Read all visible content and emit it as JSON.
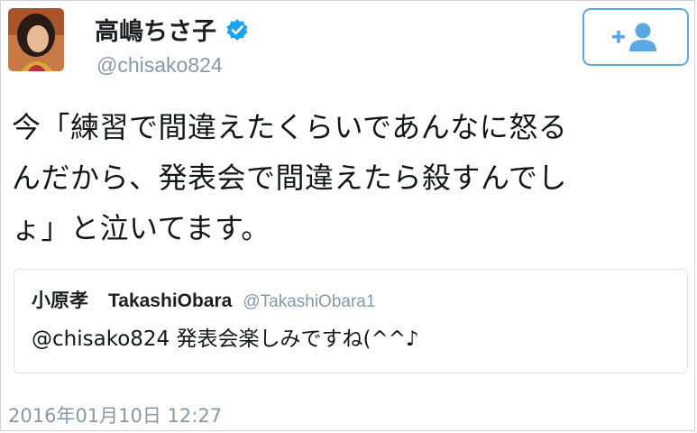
{
  "author": {
    "display_name": "高嶋ちさ子",
    "handle": "@chisako824",
    "verified": true,
    "avatar": "profile-photo"
  },
  "follow_button": {
    "icon": "follow-user-icon",
    "color": "#5ba9e2"
  },
  "tweet": {
    "text": "今「練習で間違えたくらいであんなに怒る\nんだから、発表会で間違えたら殺すんでし\nょ」と泣いてます。",
    "timestamp": "2016年01月10日 12:27"
  },
  "quoted_tweet": {
    "name": "小原孝",
    "screen_name": "TakashiObara",
    "handle": "@TakashiObara1",
    "text": "@chisako824 発表会楽しみですね(^^♪"
  },
  "colors": {
    "accent": "#1da1f2",
    "muted": "#8899a6"
  }
}
